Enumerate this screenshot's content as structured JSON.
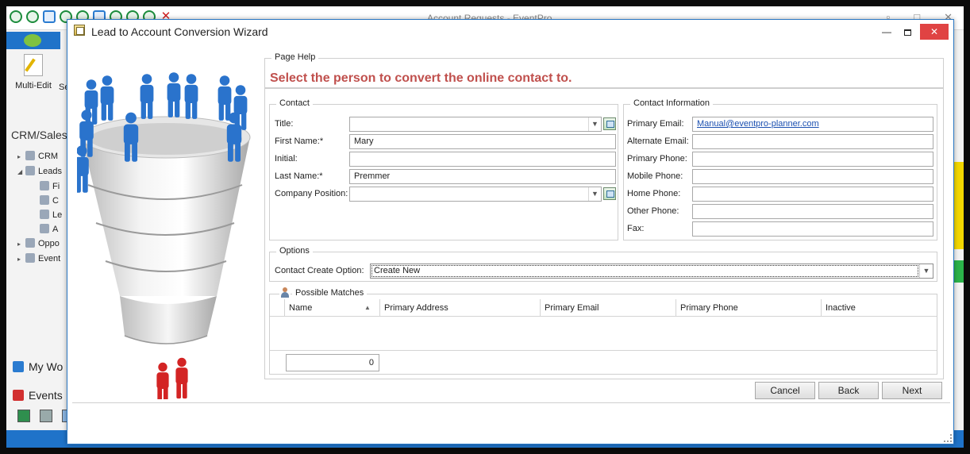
{
  "app": {
    "title": "Account Requests - EventPro",
    "ribbon": {
      "multi_edit": "Multi-Edit",
      "second": "Se"
    },
    "nav_header": "CRM/Sales",
    "tree": [
      {
        "label": "CRM",
        "toggle": "▸"
      },
      {
        "label": "Leads",
        "toggle": "◢"
      },
      {
        "label": "Fi",
        "toggle": ""
      },
      {
        "label": "C",
        "toggle": ""
      },
      {
        "label": "Le",
        "toggle": ""
      },
      {
        "label": "A",
        "toggle": ""
      },
      {
        "label": "Oppo",
        "toggle": "▸"
      },
      {
        "label": "Event",
        "toggle": "▸"
      }
    ],
    "bottom_nav": {
      "my_work": "My Wo",
      "events": "Events"
    }
  },
  "dialog": {
    "title": "Lead to Account Conversion Wizard",
    "minimize": "—",
    "close": "✕"
  },
  "page_help": {
    "legend": "Page Help",
    "text": "Select the person to convert the online contact to."
  },
  "contact": {
    "legend": "Contact",
    "title_label": "Title:",
    "title_value": "",
    "first_name_label": "First Name:*",
    "first_name_value": "Mary",
    "initial_label": "Initial:",
    "initial_value": "",
    "last_name_label": "Last Name:*",
    "last_name_value": "Premmer",
    "company_position_label": "Company Position:",
    "company_position_value": ""
  },
  "contact_info": {
    "legend": "Contact Information",
    "primary_email_label": "Primary Email:",
    "primary_email_value": "Manual@eventpro-planner.com",
    "alternate_email_label": "Alternate Email:",
    "primary_phone_label": "Primary Phone:",
    "mobile_phone_label": "Mobile Phone:",
    "home_phone_label": "Home Phone:",
    "other_phone_label": "Other Phone:",
    "fax_label": "Fax:"
  },
  "options": {
    "legend": "Options",
    "create_option_label": "Contact Create Option:",
    "create_option_value": "Create New"
  },
  "possible_matches": {
    "legend": "Possible Matches",
    "columns": [
      "Name",
      "Primary Address",
      "Primary Email",
      "Primary Phone",
      "Inactive"
    ],
    "count": "0"
  },
  "buttons": {
    "cancel": "Cancel",
    "back": "Back",
    "next": "Next"
  },
  "colors": {
    "help_text": "#c0504d",
    "accent": "#1f73c9",
    "close": "#e04343"
  }
}
